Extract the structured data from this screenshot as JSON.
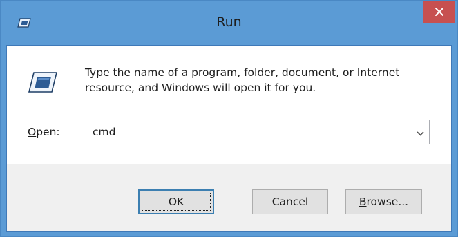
{
  "window": {
    "title": "Run",
    "title_icon": "run-icon",
    "close_icon": "close-icon",
    "titlebar_color": "#5b9bd5",
    "close_color": "#c75050"
  },
  "content": {
    "icon": "run-icon",
    "description": "Type the name of a program, folder, document, or Internet resource, and Windows will open it for you."
  },
  "open_field": {
    "label_accesskey": "O",
    "label_rest": "pen:",
    "value": "cmd",
    "dropdown_icon": "chevron-down-icon"
  },
  "buttons": {
    "ok": "OK",
    "cancel": "Cancel",
    "browse_accesskey": "B",
    "browse_rest": "rowse..."
  }
}
